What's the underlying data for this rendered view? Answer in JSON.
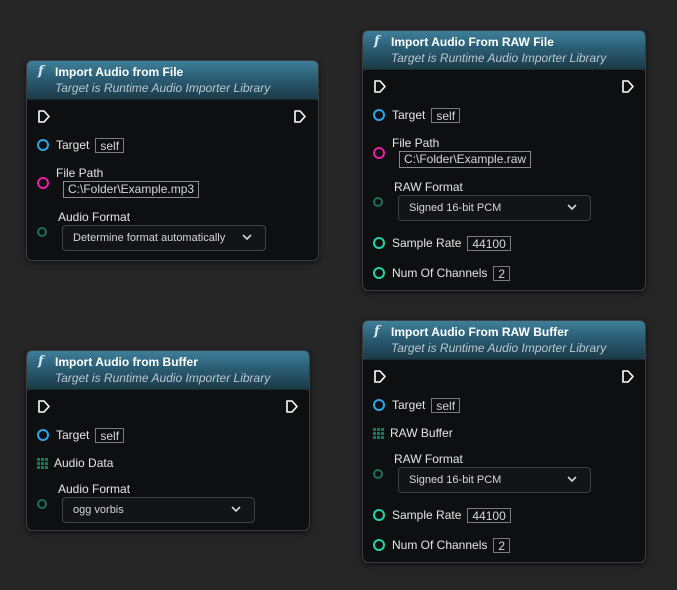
{
  "nodes": {
    "file": {
      "title": "Import Audio from File",
      "subtitle": "Target is Runtime Audio Importer Library",
      "target_label": "Target",
      "target_value": "self",
      "path_label": "File Path",
      "path_value": "C:\\Folder\\Example.mp3",
      "format_label": "Audio Format",
      "format_value": "Determine format automatically"
    },
    "raw_file": {
      "title": "Import Audio From RAW File",
      "subtitle": "Target is Runtime Audio Importer Library",
      "target_label": "Target",
      "target_value": "self",
      "path_label": "File Path",
      "path_value": "C:\\Folder\\Example.raw",
      "format_label": "RAW Format",
      "format_value": "Signed 16-bit PCM",
      "sample_rate_label": "Sample Rate",
      "sample_rate_value": "44100",
      "channels_label": "Num Of Channels",
      "channels_value": "2"
    },
    "buffer": {
      "title": "Import Audio from Buffer",
      "subtitle": "Target is Runtime Audio Importer Library",
      "target_label": "Target",
      "target_value": "self",
      "data_label": "Audio Data",
      "format_label": "Audio Format",
      "format_value": "ogg vorbis"
    },
    "raw_buffer": {
      "title": "Import Audio From RAW Buffer",
      "subtitle": "Target is Runtime Audio Importer Library",
      "target_label": "Target",
      "target_value": "self",
      "buffer_label": "RAW Buffer",
      "format_label": "RAW Format",
      "format_value": "Signed 16-bit PCM",
      "sample_rate_label": "Sample Rate",
      "sample_rate_value": "44100",
      "channels_label": "Num Of Channels",
      "channels_value": "2"
    }
  },
  "colors": {
    "object_pin": "#2aa6e6",
    "string_pin": "#e81fa8",
    "int_pin": "#1ed6a8",
    "header": "#2a5d73"
  },
  "icons": {
    "function": "function-icon",
    "exec": "exec-pin-icon",
    "array": "array-pin-icon",
    "chevron": "chevron-down-icon"
  }
}
